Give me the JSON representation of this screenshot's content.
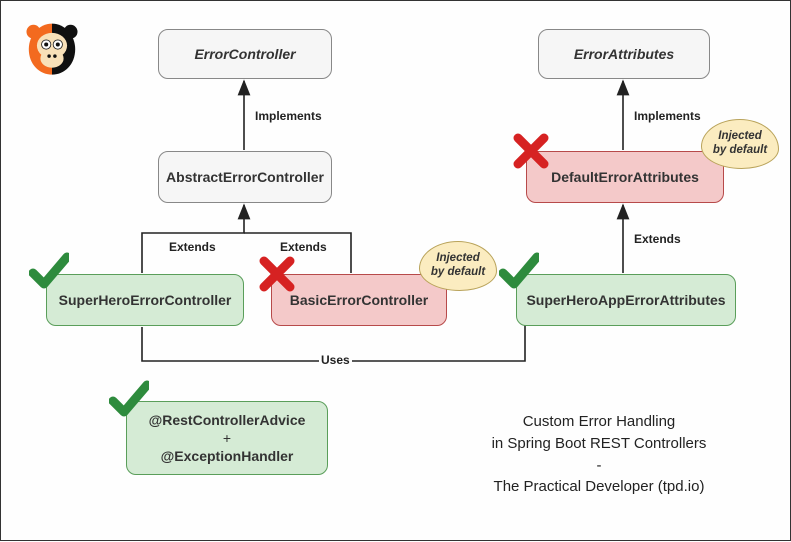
{
  "nodes": {
    "errorController": "ErrorController",
    "abstractErrorController": "AbstractErrorController",
    "superHeroErrorController": "SuperHeroErrorController",
    "basicErrorController": "BasicErrorController",
    "errorAttributes": "ErrorAttributes",
    "defaultErrorAttributes": "DefaultErrorAttributes",
    "superHeroAppErrorAttributes": "SuperHeroAppErrorAttributes",
    "adviceLine1": "@RestControllerAdvice",
    "advicePlus": "+",
    "adviceLine2": "@ExceptionHandler"
  },
  "edges": {
    "implements1": "Implements",
    "implements2": "Implements",
    "extends1": "Extends",
    "extends2": "Extends",
    "extends3": "Extends",
    "uses": "Uses"
  },
  "clouds": {
    "injected1": "Injected\nby default",
    "injected2": "Injected\nby default"
  },
  "caption": {
    "line1": "Custom Error Handling",
    "line2": "in Spring Boot REST Controllers",
    "line3": "-",
    "line4": "The Practical Developer (tpd.io)"
  }
}
